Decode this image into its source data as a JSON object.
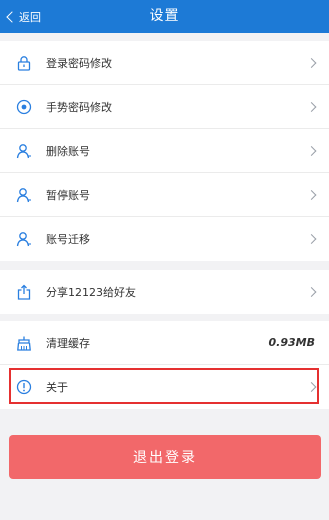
{
  "titlebar": {
    "back_label": "返回",
    "title": "设置",
    "background": "#1d7ad6"
  },
  "security_group": {
    "items": [
      {
        "label": "登录密码修改",
        "icon": "lock-icon"
      },
      {
        "label": "手势密码修改",
        "icon": "gesture-dot-icon"
      },
      {
        "label": "删除账号",
        "icon": "user-icon"
      },
      {
        "label": "暂停账号",
        "icon": "user-icon"
      },
      {
        "label": "账号迁移",
        "icon": "user-icon"
      }
    ]
  },
  "share_group": {
    "items": [
      {
        "label": "分享12123给好友",
        "icon": "share-icon"
      }
    ]
  },
  "misc_group": {
    "items": [
      {
        "label": "清理缓存",
        "value": "0.93MB",
        "icon": "broom-icon"
      },
      {
        "label": "关于",
        "icon": "info-icon"
      }
    ]
  },
  "logout": {
    "label": "退出登录",
    "color": "#f2686a"
  },
  "colors": {
    "accent": "#1d7ad6",
    "icon": "#2a7fe0",
    "highlight_border": "#e53030"
  }
}
